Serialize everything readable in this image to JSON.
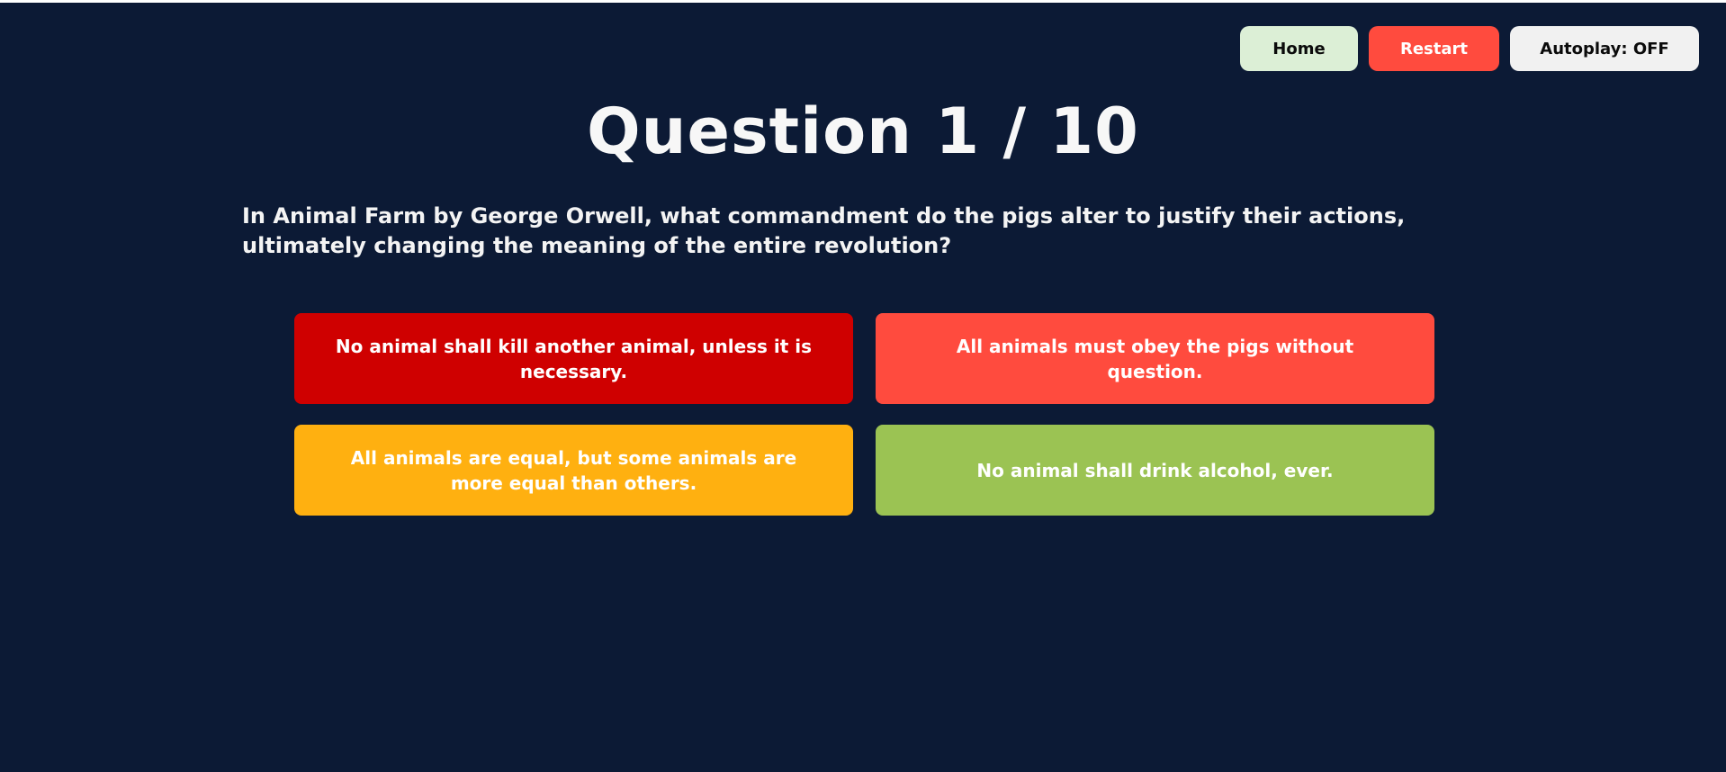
{
  "nav": {
    "home_label": "Home",
    "restart_label": "Restart",
    "autoplay_label": "Autoplay: OFF"
  },
  "quiz": {
    "title": "Question 1 / 10",
    "question": "In Animal Farm by George Orwell, what commandment do the pigs alter to justify their actions, ultimately changing the meaning of the entire revolution?",
    "answers": [
      {
        "label": "No animal shall kill another animal, unless it is necessary.",
        "color": "#cf0000"
      },
      {
        "label": "All animals must obey the pigs without question.",
        "color": "#ff4b3e"
      },
      {
        "label": "All animals are equal, but some animals are more equal than others.",
        "color": "#ffb010"
      },
      {
        "label": "No animal shall drink alcohol, ever.",
        "color": "#9bc353"
      }
    ]
  },
  "colors": {
    "background": "#0c1a35",
    "home_button": "#dcefd6",
    "restart_button": "#ff4b3e",
    "autoplay_button": "#f1f1f1"
  }
}
